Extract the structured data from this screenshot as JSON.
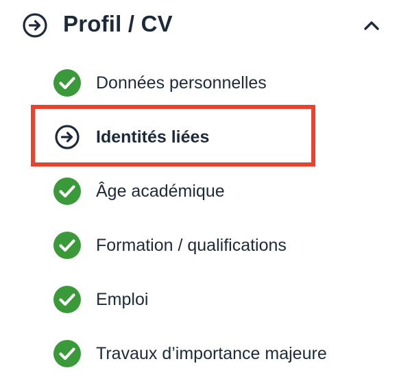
{
  "section": {
    "title": "Profil / CV",
    "icon": "arrow-right-circle-icon",
    "toggle_icon": "chevron-up-icon",
    "expanded": true
  },
  "colors": {
    "text": "#1c2a3a",
    "check_green": "#3a9a3a",
    "highlight": "#e8432f"
  },
  "items": [
    {
      "label": "Données personnelles",
      "status": "complete",
      "icon": "check-circle-icon",
      "active": false
    },
    {
      "label": "Identités liées",
      "status": "current",
      "icon": "arrow-right-circle-icon",
      "active": true
    },
    {
      "label": "Âge académique",
      "status": "complete",
      "icon": "check-circle-icon",
      "active": false
    },
    {
      "label": "Formation / qualifications",
      "status": "complete",
      "icon": "check-circle-icon",
      "active": false
    },
    {
      "label": "Emploi",
      "status": "complete",
      "icon": "check-circle-icon",
      "active": false
    },
    {
      "label": "Travaux d’importance majeure",
      "status": "complete",
      "icon": "check-circle-icon",
      "active": false
    }
  ]
}
